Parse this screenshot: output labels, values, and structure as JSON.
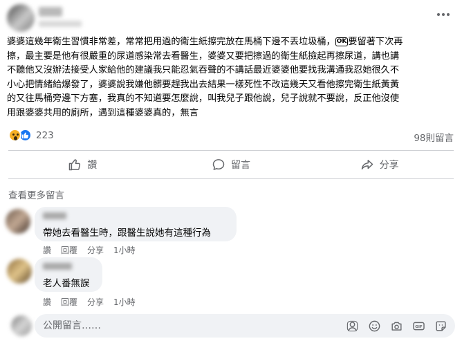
{
  "post": {
    "lines": [
      "婆婆這幾年衛生習慣非常差，常常把用過的衛生紙擦完放在馬桶下邊不丟垃圾桶，",
      "擦，最主要是他有很嚴重的尿道感染常去看醫生，婆婆又要把擦過的衛生紙撿起再擦尿道，講也講",
      "不聽他又沒辦法接受人家給他的建議我只能忍氣吞聲的不講話最近婆婆他要找我溝通我忍她很久不",
      "小心把情緒給爆發了，婆婆說我嫌他髒要趕我出去結果一樣死性不改這幾天又看他擦完衛生紙黃黃",
      "的又往馬桶旁邊下方塞，我真的不知道要怎麼說，叫我兒子跟他說，兒子說就不要說，反正他沒使",
      "用跟婆婆共用的廁所，遇到這種婆婆真的，無言"
    ],
    "line1_emoji": "OK",
    "line1_tail": "要留著下次再",
    "reaction_count": "223",
    "comment_count": "98則留言"
  },
  "actions": {
    "like": "讚",
    "comment": "留言",
    "share": "分享"
  },
  "see_more": "查看更多留言",
  "comments": [
    {
      "text": "帶她去看醫生時，跟醫生說她有這種行為",
      "like": "讚",
      "reply": "回覆",
      "share": "分享",
      "time": "1小時"
    },
    {
      "text": "老人番無誤",
      "like": "讚",
      "reply": "回覆",
      "share": "分享",
      "time": "1小時"
    }
  ],
  "composer": {
    "placeholder": "公開留言……"
  },
  "colors": {
    "text": "#050505",
    "secondary": "#65676b",
    "bubble": "#f0f2f5",
    "like_blue": "#1877f2",
    "wow_yellow": "#f7b125"
  }
}
